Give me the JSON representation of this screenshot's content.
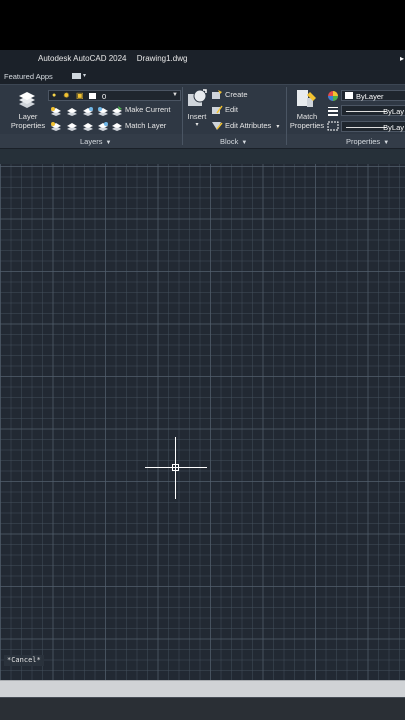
{
  "app": {
    "product": "Autodesk AutoCAD 2024",
    "document": "Drawing1.dwg"
  },
  "tabs": {
    "featured_apps": "Featured Apps"
  },
  "ribbon": {
    "layers_panel": {
      "title": "Layers",
      "layer_properties_line1": "Layer",
      "layer_properties_line2": "Properties",
      "current_layer": "0",
      "make_current": "Make Current",
      "match_layer": "Match Layer"
    },
    "block_panel": {
      "title": "Block",
      "insert": "Insert",
      "create": "Create",
      "edit": "Edit",
      "edit_attributes": "Edit Attributes"
    },
    "properties_panel": {
      "title": "Properties",
      "match_line1": "Match",
      "match_line2": "Properties",
      "color": "ByLayer",
      "linetype": "ByLay",
      "lineweight": "ByLay"
    }
  },
  "command": {
    "history": "*Cancel*"
  },
  "colors": {
    "canvas_bg": "#222933",
    "ribbon_bg": "#2f3844",
    "crosshair": "#ffffff"
  }
}
